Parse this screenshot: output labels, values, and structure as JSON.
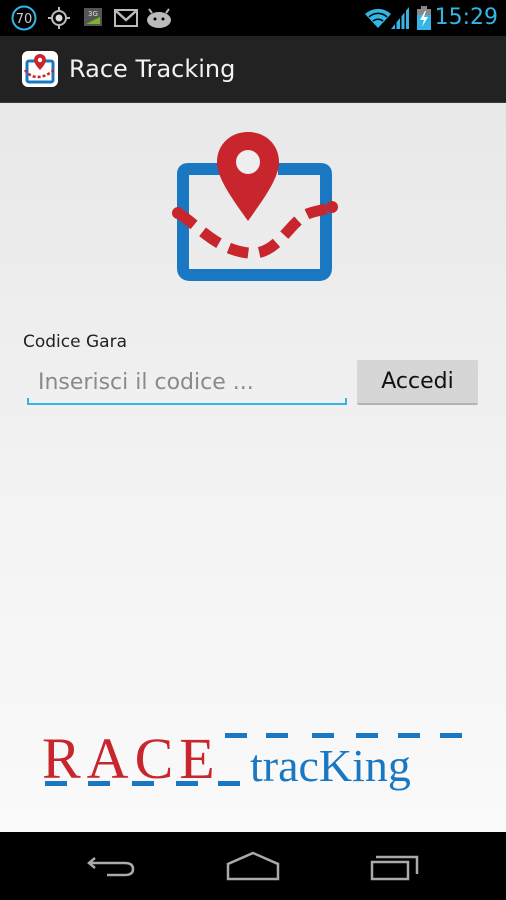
{
  "status_bar": {
    "notification_badge": "70",
    "icons": [
      "notification-count-icon",
      "gps-icon",
      "3g-data-icon",
      "gmail-icon",
      "android-debug-icon"
    ],
    "right_icons": [
      "wifi-icon",
      "cell-signal-icon",
      "battery-charging-icon"
    ],
    "data_label": "3G",
    "time": "15:29",
    "accent_color": "#33b5e5"
  },
  "action_bar": {
    "title": "Race Tracking"
  },
  "form": {
    "label": "Codice Gara",
    "input_value": "",
    "input_placeholder": "Inserisci il codice ...",
    "submit_label": "Accedi"
  },
  "brand": {
    "word_primary": "RACE",
    "word_secondary": "tracKing",
    "primary_color": "#c8262c",
    "secondary_color": "#1a78c2"
  },
  "nav_bar": {
    "buttons": [
      "back",
      "home",
      "recent-apps"
    ]
  }
}
